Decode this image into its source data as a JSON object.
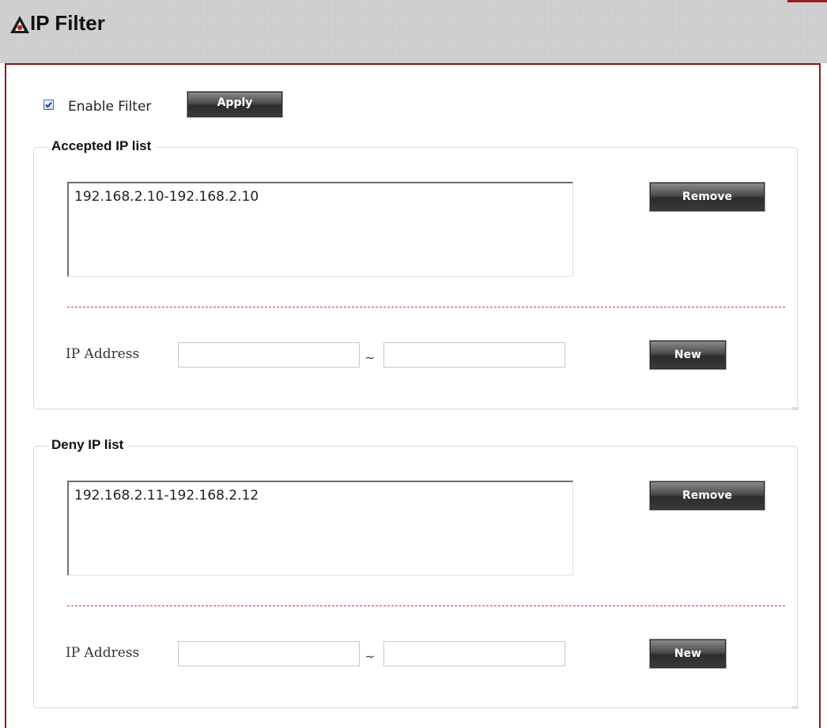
{
  "header": {
    "title": "IP Filter",
    "icon": "logo-icon",
    "colors": {
      "frame_border": "#8b1a1a",
      "header_bg": "#d8d8d8",
      "dashed_divider": "#d9343a"
    }
  },
  "controls": {
    "enable_filter_label": "Enable Filter",
    "enable_filter_checked": true,
    "apply_label": "Apply"
  },
  "accepted": {
    "legend": "Accepted IP list",
    "entries": [
      "192.168.2.10-192.168.2.10"
    ],
    "remove_label": "Remove",
    "ip_label": "IP Address",
    "range_separator": "~",
    "start_value": "",
    "end_value": "",
    "new_label": "New"
  },
  "deny": {
    "legend": "Deny IP list",
    "entries": [
      "192.168.2.11-192.168.2.12"
    ],
    "remove_label": "Remove",
    "ip_label": "IP Address",
    "range_separator": "~",
    "start_value": "",
    "end_value": "",
    "new_label": "New"
  }
}
